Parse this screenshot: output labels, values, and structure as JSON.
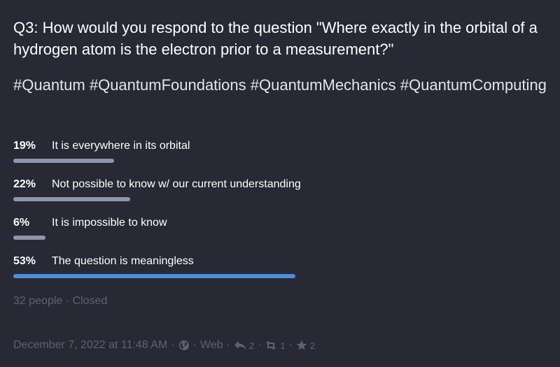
{
  "question": "Q3: How would you respond to the question \"Where exactly in the orbital of a hydrogen atom is the electron prior to a measurement?\"",
  "hashtags": "#Quantum #QuantumFoundations #QuantumMechanics #QuantumComputing",
  "poll": {
    "options": [
      {
        "percent_label": "19%",
        "label": "It is everywhere in its orbital",
        "fraction": 0.19
      },
      {
        "percent_label": "22%",
        "label": "Not possible to know w/ our current understanding",
        "fraction": 0.22
      },
      {
        "percent_label": "6%",
        "label": "It is impossible to know",
        "fraction": 0.06
      },
      {
        "percent_label": "53%",
        "label": "The question is meaningless",
        "fraction": 0.53,
        "leading": true
      }
    ],
    "voters": "32 people",
    "status": "Closed"
  },
  "footer": {
    "timestamp": "December 7, 2022 at 11:48 AM",
    "visibility_icon": "globe-icon",
    "source": "Web",
    "reply_count": "2",
    "boost_count": "1",
    "favourite_count": "2"
  },
  "colors": {
    "background": "#282934",
    "bar": "#8f95ab",
    "bar_leading": "#4a8fdf",
    "muted_text": "#5e6275"
  }
}
